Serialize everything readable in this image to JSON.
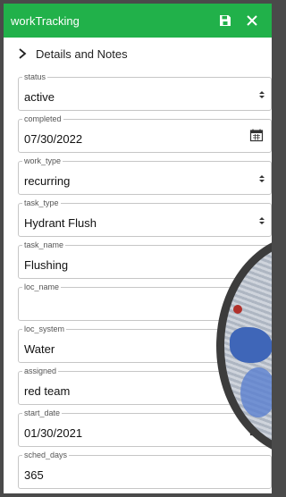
{
  "window": {
    "title": "workTracking"
  },
  "section": {
    "label": "Details and Notes"
  },
  "fields": [
    {
      "label": "status",
      "value": "active",
      "control": "select"
    },
    {
      "label": "completed",
      "value": "07/30/2022",
      "control": "date"
    },
    {
      "label": "work_type",
      "value": "recurring",
      "control": "select"
    },
    {
      "label": "task_type",
      "value": "Hydrant Flush",
      "control": "select"
    },
    {
      "label": "task_name",
      "value": "Flushing",
      "control": "text"
    },
    {
      "label": "loc_name",
      "value": "",
      "control": "text"
    },
    {
      "label": "loc_system",
      "value": "Water",
      "control": "text"
    },
    {
      "label": "assigned",
      "value": "red team",
      "control": "text"
    },
    {
      "label": "start_date",
      "value": "01/30/2021",
      "control": "date"
    },
    {
      "label": "sched_days",
      "value": "365",
      "control": "text"
    }
  ],
  "colors": {
    "titlebar": "#21b14a",
    "field_border": "#c6c6c6"
  },
  "icons": {
    "save": "save-icon",
    "close": "close-icon",
    "expand": "chevron-right-icon",
    "calendar": "calendar-icon",
    "select": "select-caret-icon"
  }
}
